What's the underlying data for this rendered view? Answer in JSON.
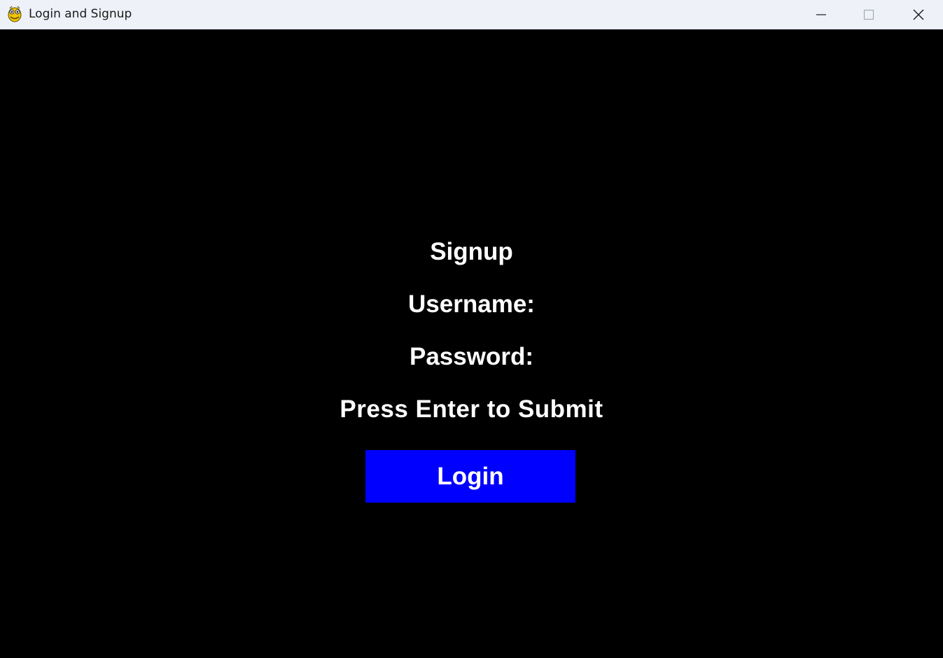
{
  "window": {
    "title": "Login and Signup",
    "icon": "pygame-snake-icon",
    "controls": {
      "minimize_icon": "minimize-icon",
      "maximize_icon": "maximize-icon",
      "close_icon": "close-icon"
    }
  },
  "form": {
    "heading": "Signup",
    "username_label": "Username:",
    "username_value": "",
    "password_label": "Password:",
    "password_value": "",
    "hint": "Press Enter to Submit",
    "login_button_label": "Login"
  },
  "colors": {
    "background": "#000000",
    "text": "#ffffff",
    "button": "#0000ff",
    "titlebar": "#eef1f8"
  }
}
